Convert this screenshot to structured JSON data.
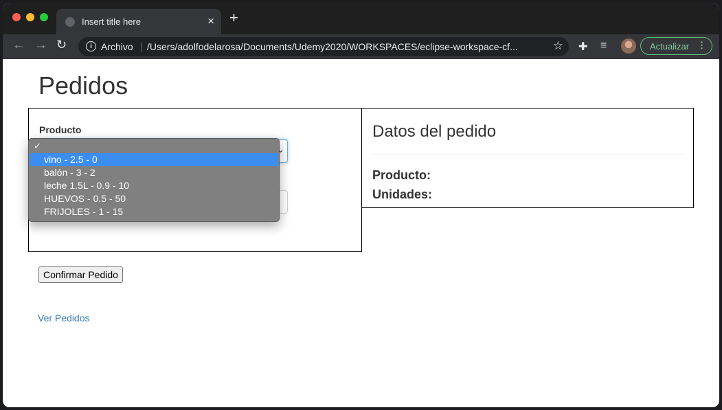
{
  "browser": {
    "tab_title": "Insert title here",
    "tab_close": "×",
    "new_tab": "+",
    "scheme_label": "Archivo",
    "url": "/Users/adolfodelarosa/Documents/Udemy2020/WORKSPACES/eclipse-workspace-cf...",
    "update_label": "Actualizar",
    "icons": {
      "back": "back-arrow-icon",
      "forward": "forward-arrow-icon",
      "reload": "reload-icon",
      "info": "info-icon",
      "star": "star-icon",
      "extensions": "puzzle-icon",
      "media": "media-queue-icon",
      "menu": "more-vert-icon"
    }
  },
  "page": {
    "title": "Pedidos",
    "form": {
      "product_label": "Producto",
      "options": [
        {
          "label": "",
          "checked": true
        },
        {
          "label": "vino - 2.5 - 0",
          "highlighted": true
        },
        {
          "label": "balón - 3 - 2"
        },
        {
          "label": "leche 1.5L - 0.9 - 10"
        },
        {
          "label": "HUEVOS - 0.5 - 50"
        },
        {
          "label": "FRIJOLES - 1 - 15"
        }
      ],
      "confirm_label": "Confirmar Pedido"
    },
    "details": {
      "heading": "Datos del pedido",
      "product_label": "Producto:",
      "units_label": "Unidades:"
    },
    "link_label": "Ver Pedidos"
  },
  "colors": {
    "highlight": "#3b8ef0",
    "link": "#337ab7",
    "update_accent": "#81c995"
  }
}
